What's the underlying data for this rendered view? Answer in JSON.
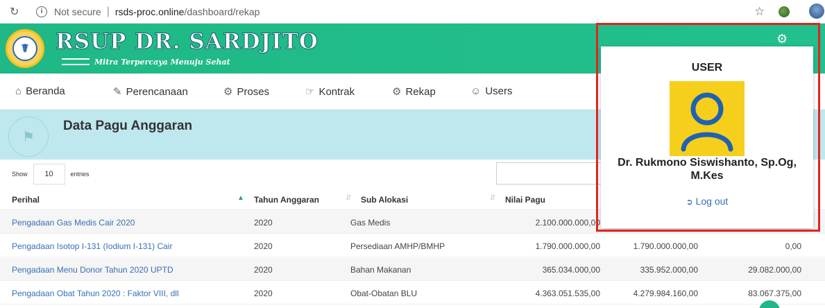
{
  "browser": {
    "security_label": "Not secure",
    "url_host": "rsds-proc.online",
    "url_path": "/dashboard/rekap"
  },
  "header": {
    "brand": "RSUP DR. SARDJITO",
    "tagline": "Mitra Terpercaya Menuju Sehat",
    "bg_color": "#22c08e"
  },
  "nav": {
    "items": [
      {
        "label": "Beranda",
        "icon": "home-icon"
      },
      {
        "label": "Perencanaan",
        "icon": "pencil-icon"
      },
      {
        "label": "Proses",
        "icon": "gear-icon"
      },
      {
        "label": "Kontrak",
        "icon": "handshake-icon"
      },
      {
        "label": "Rekap",
        "icon": "gear-icon"
      },
      {
        "label": "Users",
        "icon": "users-icon"
      }
    ]
  },
  "page": {
    "title": "Data Pagu Anggaran"
  },
  "table_controls": {
    "show_label": "Show",
    "entries_value": "10",
    "entries_label": "entries"
  },
  "table": {
    "columns": [
      "Perihal",
      "Tahun Anggaran",
      "Sub Alokasi",
      "Nilai Pagu"
    ],
    "rows": [
      {
        "perihal": "Pengadaan Gas Medis Cair 2020",
        "tahun": "2020",
        "sub": "Gas Medis",
        "pagu": "2.100.000.000,00",
        "col5": "",
        "col6": ""
      },
      {
        "perihal": "Pengadaan Isotop I-131 (Iodium I-131) Cair",
        "tahun": "2020",
        "sub": "Persediaan AMHP/BMHP",
        "pagu": "1.790.000.000,00",
        "col5": "1.790.000.000,00",
        "col6": "0,00"
      },
      {
        "perihal": "Pengadaan Menu Donor Tahun 2020 UPTD",
        "tahun": "2020",
        "sub": "Bahan Makanan",
        "pagu": "365.034.000,00",
        "col5": "335.952.000,00",
        "col6": "29.082.000,00"
      },
      {
        "perihal": "Pengadaan Obat Tahun 2020 : Faktor VIII, dll",
        "tahun": "2020",
        "sub": "Obat-Obatan BLU",
        "pagu": "4.363.051.535,00",
        "col5": "4.279.984.160,00",
        "col6": "83.067.375,00"
      }
    ]
  },
  "user_popup": {
    "title": "USER",
    "name": "Dr. Rukmono Siswishanto, Sp.Og, M.Kes",
    "logout_label": "Log out",
    "avatar_color": "#f5cf1c",
    "avatar_icon": "user-icon"
  }
}
